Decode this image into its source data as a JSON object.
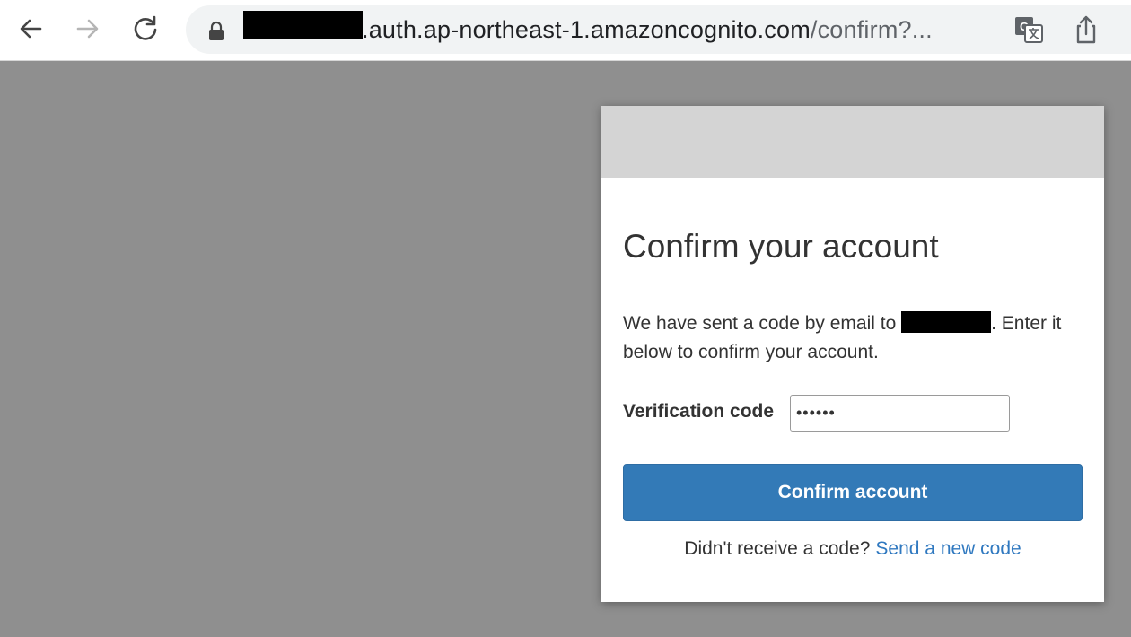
{
  "browser": {
    "url_visible": ".auth.ap-northeast-1.amazoncognito.com",
    "url_rest": "/confirm?...",
    "icons": {
      "back": "arrow-left-icon",
      "forward": "arrow-right-icon",
      "reload": "reload-icon",
      "lock": "lock-icon",
      "translate": "translate-icon",
      "share": "share-icon"
    }
  },
  "card": {
    "title": "Confirm your account",
    "message_part1": "We have sent a code by email to ",
    "message_part2": ". Enter it below to confirm your account.",
    "code_label": "Verification code",
    "code_value": "••••••",
    "confirm_label": "Confirm account",
    "resend_prompt": "Didn't receive a code?",
    "resend_link": "Send a new code"
  },
  "colors": {
    "backdrop": "#8f8f8f",
    "banner": "#d4d4d4",
    "primary_button": "#337ab7",
    "link": "#3079c0"
  }
}
